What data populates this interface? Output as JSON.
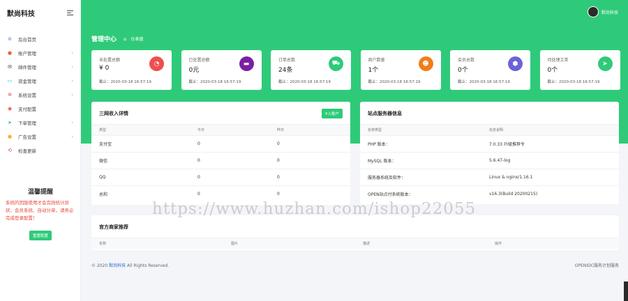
{
  "brand": {
    "name": "默尚科技"
  },
  "sidebar": {
    "items": [
      {
        "label": "后台首页",
        "icon": "⊘",
        "color": "#4a7bd8",
        "chev": ""
      },
      {
        "label": "账户管理",
        "icon": "●",
        "color": "#e8643a",
        "chev": "›"
      },
      {
        "label": "邮件管理",
        "icon": "✉",
        "color": "#333333",
        "chev": "›"
      },
      {
        "label": "资金管理",
        "icon": "▭",
        "color": "#2bb5c9",
        "chev": "›"
      },
      {
        "label": "系统设置",
        "icon": "✲",
        "color": "#e8473a",
        "chev": "›"
      },
      {
        "label": "支付配置",
        "icon": "◉",
        "color": "#e8473a",
        "chev": ""
      },
      {
        "label": "下单管理",
        "icon": "➤",
        "color": "#2fca79",
        "chev": "›"
      },
      {
        "label": "广告设置",
        "icon": "●",
        "color": "#f3b52a",
        "chev": "›"
      },
      {
        "label": "检查更新",
        "icon": "⟲",
        "color": "#e8473a",
        "chev": ""
      }
    ]
  },
  "notice": {
    "title": "温馨提醒",
    "text": "系统的因版使用才会完则统计异状、会员系统、自动分单，请务必完成登录配置！",
    "button": "重置配置"
  },
  "header": {
    "username": "默尚科技"
  },
  "page": {
    "title": "管理中心",
    "breadcrumb": "仪表盘"
  },
  "stats": [
    {
      "label": "未处置总额",
      "value": "¥ 0",
      "time": "截止：2020-03-18 16:57:19",
      "icon": "◔",
      "color": "#ee4f4f"
    },
    {
      "label": "已处置总额",
      "value": "0元",
      "time": "截止：2020-03-18 16:57:19",
      "icon": "▬",
      "color": "#7b1fa2"
    },
    {
      "label": "订单总数",
      "value": "24条",
      "time": "截止：2020-03-18 16:57:19",
      "icon": "⛟",
      "color": "#2fca79"
    },
    {
      "label": "商户数量",
      "value": "1个",
      "time": "截止：2020-03-18 16:57:19",
      "icon": "☻",
      "color": "#f07d1c"
    },
    {
      "label": "会员总数",
      "value": "0个",
      "time": "截止：2020-03-18 16:57:19",
      "icon": "⬢",
      "color": "#6c63d6"
    },
    {
      "label": "待处理工单",
      "value": "0个",
      "time": "截止：2020-03-18 16:57:19",
      "icon": "➤",
      "color": "#2fca79"
    }
  ],
  "income": {
    "title": "三网收入详情",
    "button": "¥入账户",
    "columns": [
      "类型",
      "今日",
      "昨日"
    ],
    "rows": [
      [
        "支付宝",
        "0",
        "0"
      ],
      [
        "微信",
        "0",
        "0"
      ],
      [
        "QQ",
        "0",
        "0"
      ],
      [
        "总和",
        "0",
        "0"
      ]
    ]
  },
  "server": {
    "title": "站点服务器信息",
    "columns": [
      "名称类型",
      "信息说明"
    ],
    "rows": [
      [
        "PHP 版本：",
        "7.0.33 升级推荐令"
      ],
      [
        "MySQL 版本：",
        "5.6.47-log"
      ],
      [
        "服务器系统及软件：",
        "Linux & nginx/1.16.1"
      ],
      [
        "OPEN站点付系统版本：",
        "v16.3(Build 20200215)"
      ]
    ]
  },
  "recommend": {
    "title": "官方商家推荐",
    "columns": [
      "名称",
      "图片",
      "描述",
      "操作"
    ]
  },
  "footer": {
    "copyright": "© 2020",
    "brand": "默尚科技",
    "rights": "All Rights Reserved.",
    "right": "OPENIDC服务计划服务"
  },
  "watermark": "https://www.huzhan.com/ishop22055"
}
